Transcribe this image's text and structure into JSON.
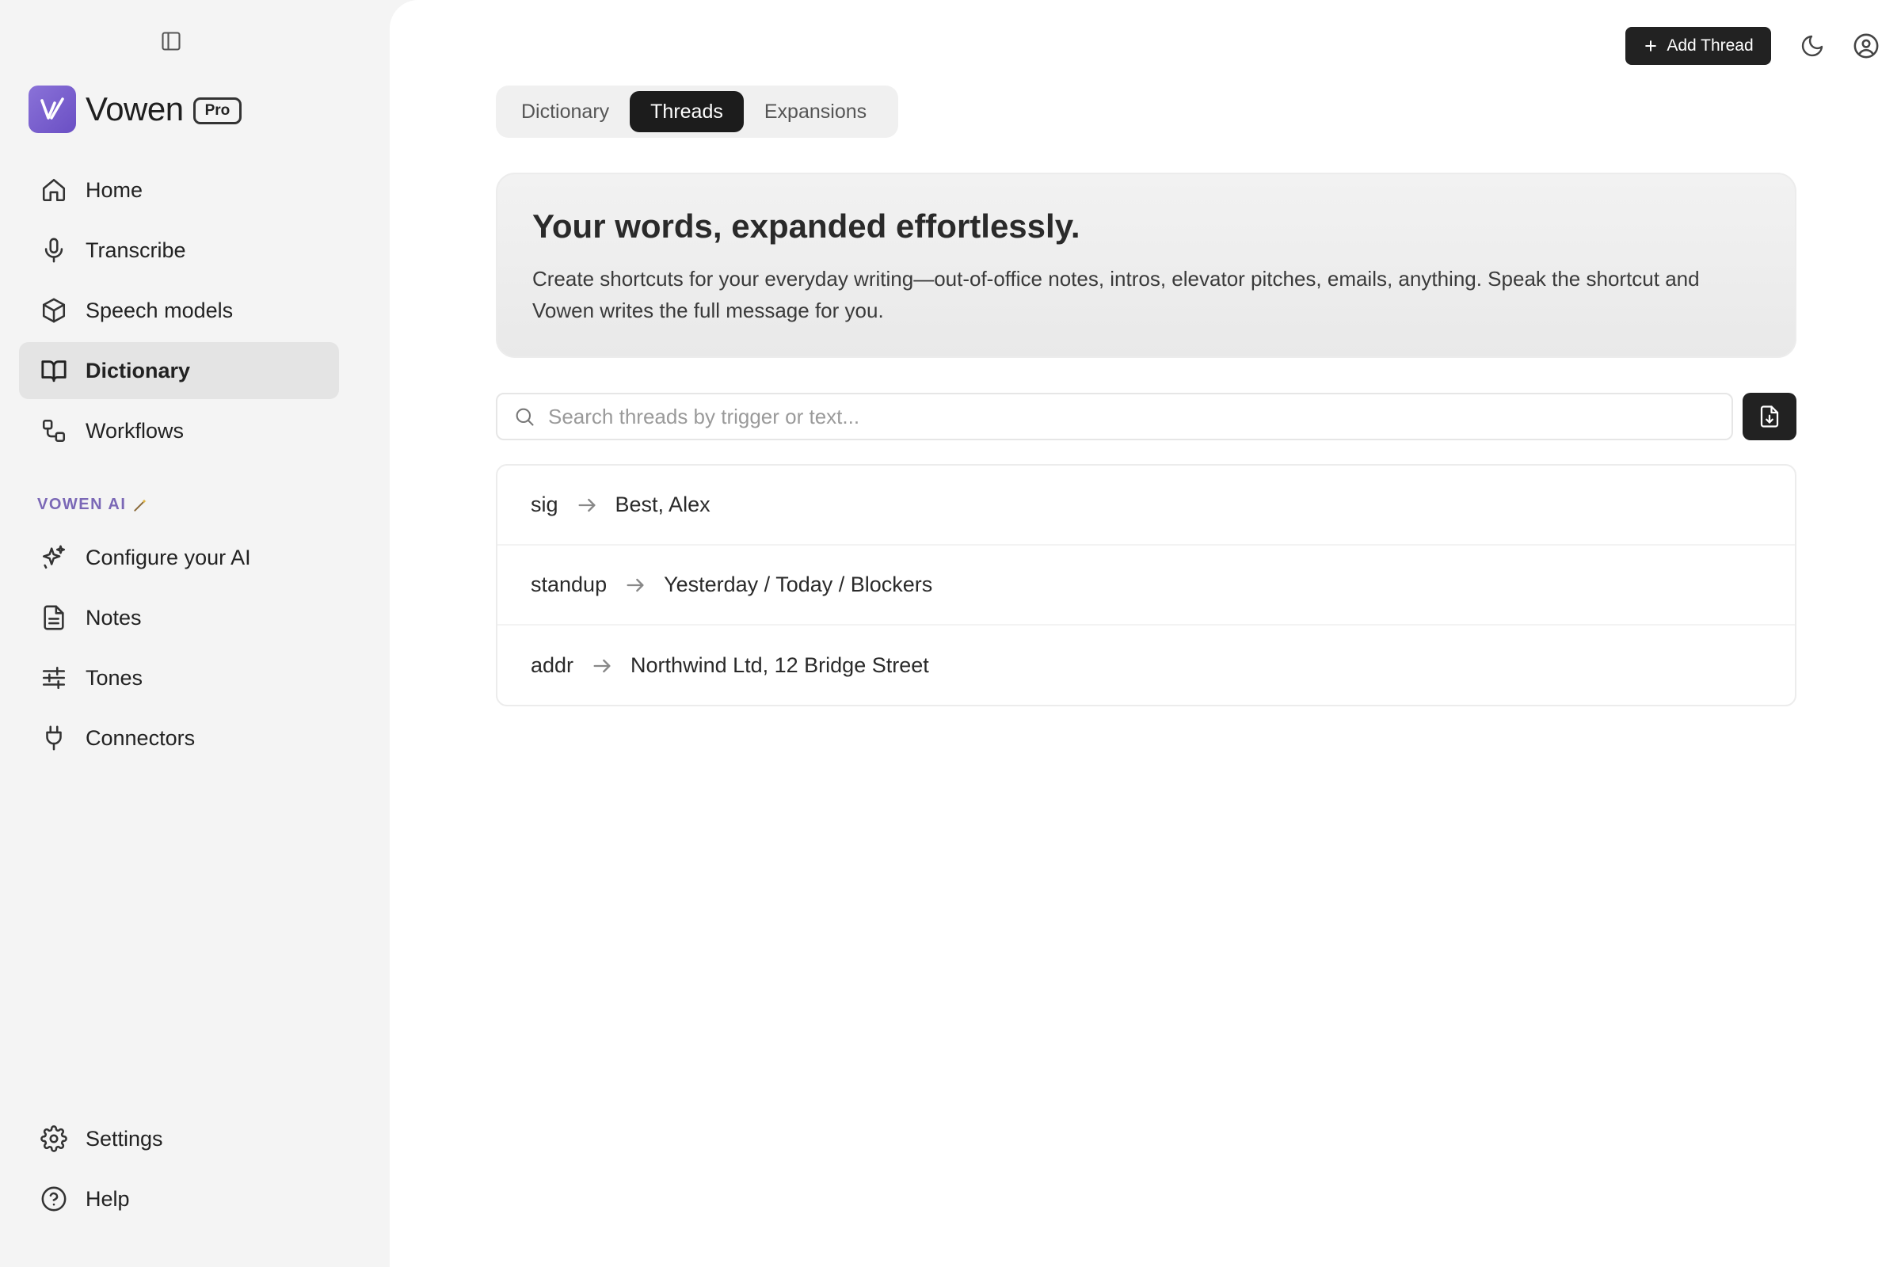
{
  "brand": {
    "name": "Vowen",
    "badge": "Pro",
    "accent": "#6a4fc4"
  },
  "sidebar": {
    "main_items": [
      {
        "label": "Home",
        "icon": "home-icon"
      },
      {
        "label": "Transcribe",
        "icon": "microphone-icon"
      },
      {
        "label": "Speech models",
        "icon": "cube-icon"
      },
      {
        "label": "Dictionary",
        "icon": "book-icon",
        "active": true
      },
      {
        "label": "Workflows",
        "icon": "workflow-icon"
      }
    ],
    "section_label": "VOWEN AI",
    "ai_items": [
      {
        "label": "Configure your AI",
        "icon": "sparkles-icon"
      },
      {
        "label": "Notes",
        "icon": "document-icon"
      },
      {
        "label": "Tones",
        "icon": "sliders-icon"
      },
      {
        "label": "Connectors",
        "icon": "plug-icon"
      }
    ],
    "bottom_items": [
      {
        "label": "Settings",
        "icon": "gear-icon"
      },
      {
        "label": "Help",
        "icon": "help-circle-icon"
      }
    ]
  },
  "topbar": {
    "add_label": "Add Thread"
  },
  "tabs": [
    {
      "label": "Dictionary"
    },
    {
      "label": "Threads",
      "active": true
    },
    {
      "label": "Expansions"
    }
  ],
  "hero": {
    "title": "Your words, expanded effortlessly.",
    "text": "Create shortcuts for your everyday writing—out-of-office notes, intros, elevator pitches, emails, anything. Speak the shortcut and Vowen writes the full message for you."
  },
  "search": {
    "placeholder": "Search threads by trigger or text...",
    "value": ""
  },
  "threads": [
    {
      "trigger": "sig",
      "expansion": "Best, Alex"
    },
    {
      "trigger": "standup",
      "expansion": "Yesterday / Today / Blockers"
    },
    {
      "trigger": "addr",
      "expansion": "Northwind Ltd, 12 Bridge Street"
    }
  ]
}
